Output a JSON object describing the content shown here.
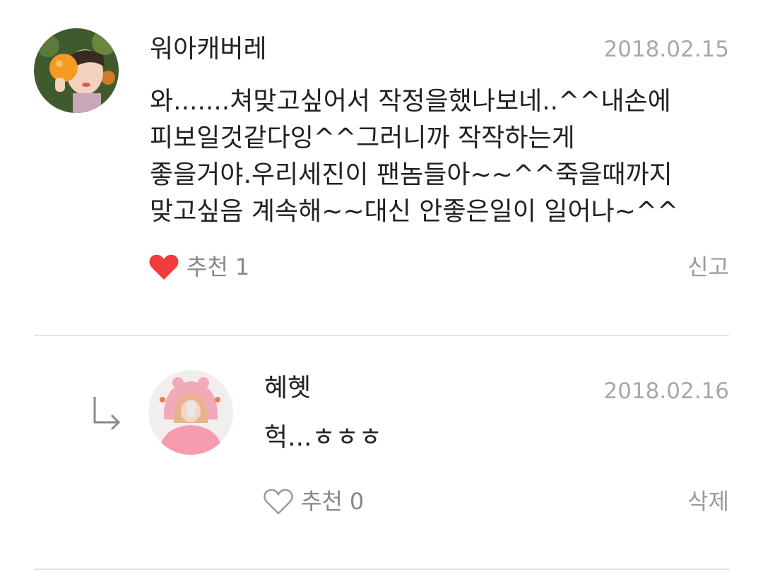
{
  "comments": [
    {
      "author": "워아캐버레",
      "date": "2018.02.15",
      "text": "와.......쳐맞고싶어서 작정을했나보네..^^내손에\n피보일것같다잉^^그러니까 작작하는게\n좋을거야.우리세진이 팬놈들아~~^^죽을때까지\n맞고싶음 계속해~~대신 안좋은일이 일어나~^^",
      "like_label": "추천",
      "like_count": "1",
      "liked": true,
      "action_label": "신고",
      "avatar_icon": "avatar-photo-orange"
    },
    {
      "author": "혜혯",
      "date": "2018.02.16",
      "text": "헉...ㅎㅎㅎ",
      "like_label": "추천",
      "like_count": "0",
      "liked": false,
      "action_label": "삭제",
      "avatar_icon": "avatar-photo-pink",
      "reply_icon": "reply-arrow-icon"
    }
  ],
  "colors": {
    "heart_filled": "#f03c3c",
    "heart_outline": "#9a9a9a",
    "date": "#a8a8a8",
    "muted": "#888888",
    "divider": "#e4e4e4"
  }
}
